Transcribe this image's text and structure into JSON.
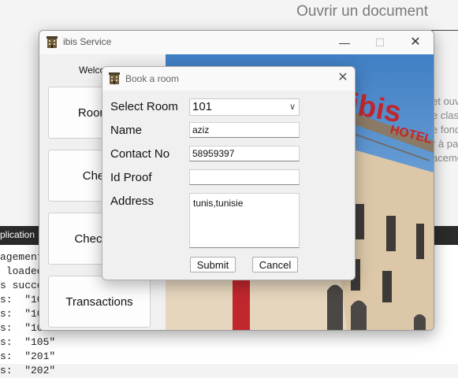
{
  "background_document": {
    "title": "Ouvrir un document",
    "text_fragments": [
      "et ouv",
      "e clas",
      "e fond",
      "r à pa",
      "acemer"
    ]
  },
  "background_console": {
    "tab_label": "plication",
    "lines": [
      "agement_",
      " loaded",
      "s succe",
      "s:  \"101",
      "s:  \"102",
      "s:  \"103",
      "s:  \"105\"",
      "s:  \"201\"",
      "s:  \"202\""
    ]
  },
  "main_window": {
    "title": "ibis Service",
    "welcome": "Welco",
    "buttons": {
      "room": "Room B",
      "check": "Check",
      "check_av": "Check Av",
      "transactions": "Transactions"
    },
    "image_text": "ibis HOTEL"
  },
  "dialog": {
    "title": "Book a room",
    "labels": {
      "room": "Select Room",
      "name": "Name",
      "contact": "Contact No",
      "id_proof": "Id Proof",
      "address": "Address"
    },
    "values": {
      "room": "101",
      "name": "aziz",
      "contact": "58959397",
      "id_proof": "",
      "address": "tunis,tunisie"
    },
    "buttons": {
      "submit": "Submit",
      "cancel": "Cancel"
    }
  },
  "colors": {
    "ibis_red": "#c0272d",
    "console_tab": "#2b2b2b"
  },
  "icons": [
    "app-hotel-icon",
    "minimize-icon",
    "maximize-icon",
    "close-icon",
    "chevron-down-icon"
  ]
}
